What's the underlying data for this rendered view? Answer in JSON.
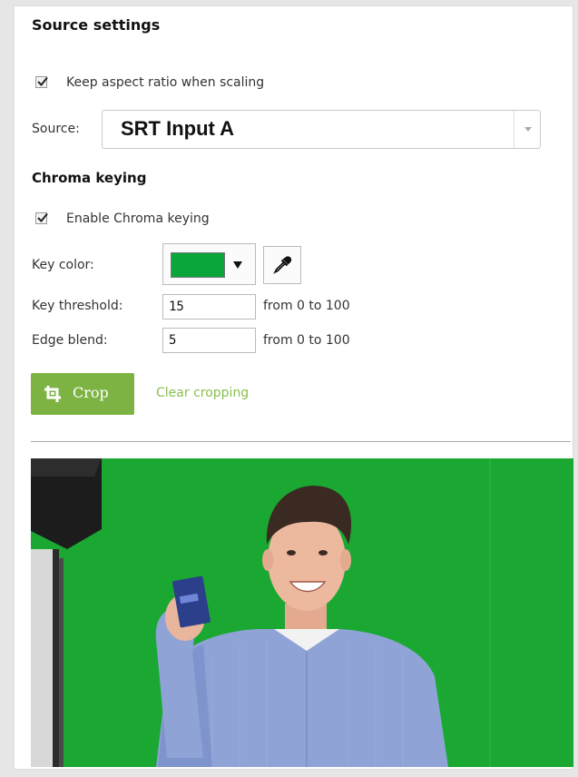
{
  "panel": {
    "title": "Source settings"
  },
  "scaling": {
    "keep_aspect_label": "Keep aspect ratio when scaling",
    "keep_aspect_checked": true
  },
  "source": {
    "label": "Source:",
    "selected": "SRT Input A"
  },
  "chroma": {
    "section_title": "Chroma keying",
    "enable_label": "Enable Chroma keying",
    "enable_checked": true,
    "key_color_label": "Key color:",
    "key_color_value": "#0ba63a",
    "eyedropper_icon": "eyedropper-icon",
    "threshold_label": "Key threshold:",
    "threshold_value": "15",
    "threshold_range": "from 0 to 100",
    "edge_label": "Edge blend:",
    "edge_value": "5",
    "edge_range": "from 0 to 100"
  },
  "crop": {
    "button_label": "Crop",
    "button_icon": "crop-icon",
    "clear_label": "Clear cropping"
  },
  "colors": {
    "accent_green": "#7cb343",
    "link_green": "#8bbf4f",
    "screen_green": "#1aa832"
  }
}
